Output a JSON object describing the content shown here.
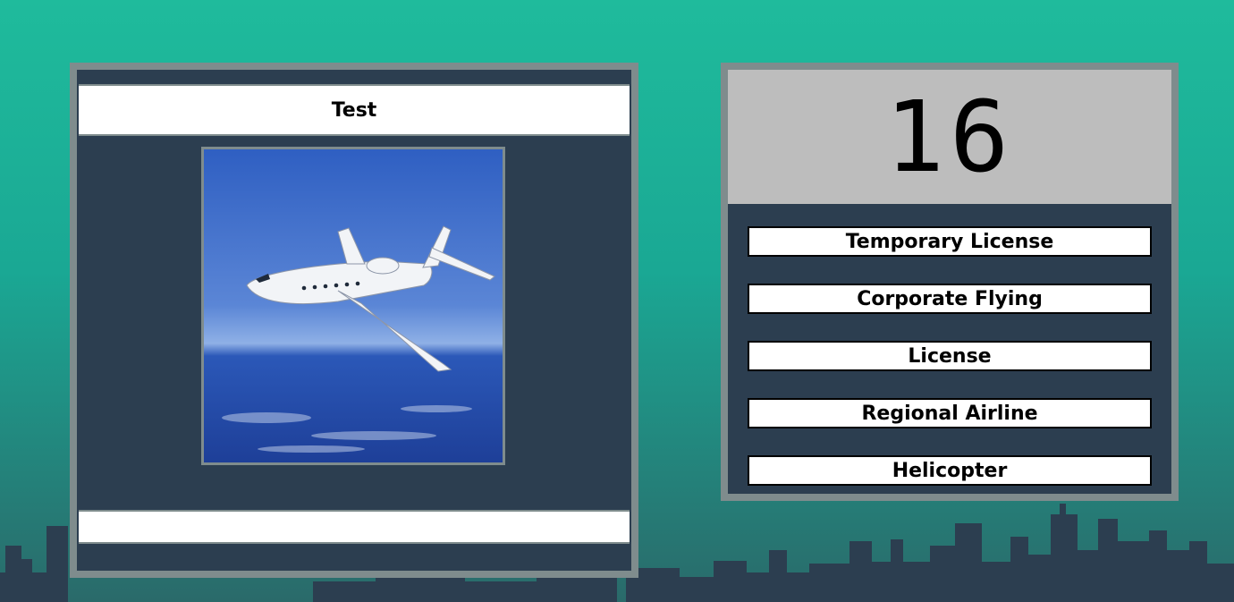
{
  "question": {
    "title": "Test",
    "footer_text": "",
    "image": {
      "subject": "business-jet-airplane-over-ocean"
    }
  },
  "score": {
    "value": "16"
  },
  "answers": [
    {
      "label": "Temporary License"
    },
    {
      "label": "Corporate Flying"
    },
    {
      "label": "License"
    },
    {
      "label": "Regional Airline"
    },
    {
      "label": "Helicopter"
    }
  ],
  "colors": {
    "background_top": "#1fbb9c",
    "panel_dark": "#2c3e50",
    "panel_border": "#7f8c8d",
    "score_bg": "#bdbdbd",
    "skyline": "#2c3e50"
  }
}
